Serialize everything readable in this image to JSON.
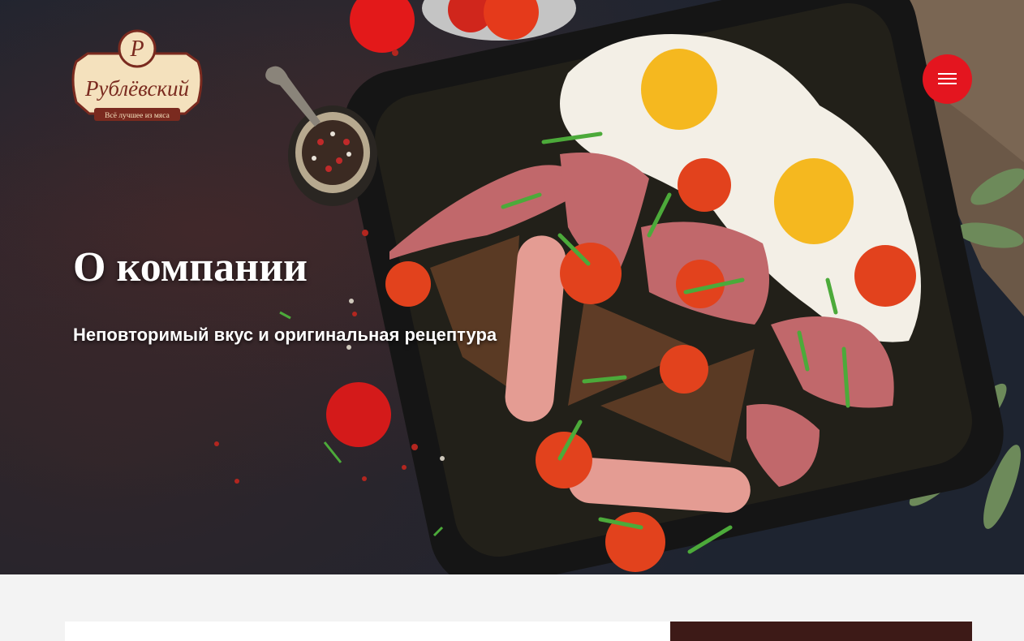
{
  "header": {
    "logo": {
      "brand": "Рублёвский",
      "tagline": "Всё лучшее из мяса",
      "monogram": "Р"
    },
    "menu_icon": "hamburger-icon"
  },
  "hero": {
    "title": "О компании",
    "subtitle": "Неповторимый вкус и оригинальная рецептура"
  },
  "colors": {
    "accent_red": "#e4151f",
    "brand_brown": "#3d1a17",
    "logo_cream": "#f4e1bd",
    "background_dark": "#1e2430"
  }
}
